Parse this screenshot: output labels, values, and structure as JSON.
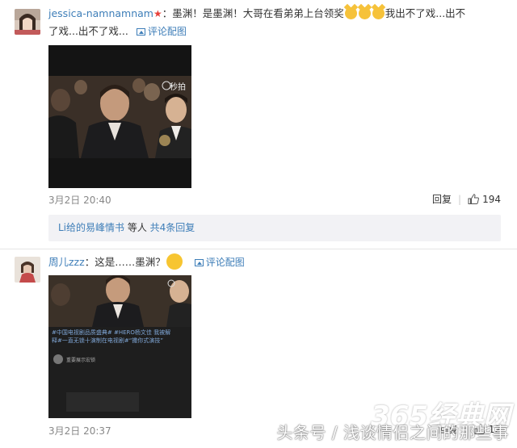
{
  "comments": [
    {
      "username": "jessica-namnamnam",
      "text_a": "：墨渊！是墨渊！大哥在看弟弟上台领奖",
      "text_b": "我出不了戏...出不",
      "text_c": "了戏...出不了戏...",
      "pic_link": "评论配图",
      "time": "3月2日 20:40",
      "reply_label": "回复",
      "like_count": "194",
      "reply_summary": {
        "user": "Li给的易峰情书",
        "mid": " 等人 ",
        "count": "共4条回复"
      },
      "video_badge": "秒拍"
    },
    {
      "username": "周儿zzz",
      "text_a": "：这是……墨渊？",
      "pic_link": "评论配图",
      "time": "3月2日 20:37",
      "reply_label": "回复",
      "like_count": "12",
      "image_caption": "#中国电视剧品质盛典# #HERO杨文佳 我被解释#一直无锁十演制在电视剧#“撒你式演技”",
      "image_user": "重要展示宏锁"
    }
  ],
  "watermark": {
    "logo": "365经典网",
    "text": "头条号 / 浅谈情侣之间的那些事"
  },
  "colors": {
    "link": "#3e7eb8",
    "meta": "#888888",
    "reply_bg": "#f2f2f5",
    "star": "#e8403a"
  }
}
